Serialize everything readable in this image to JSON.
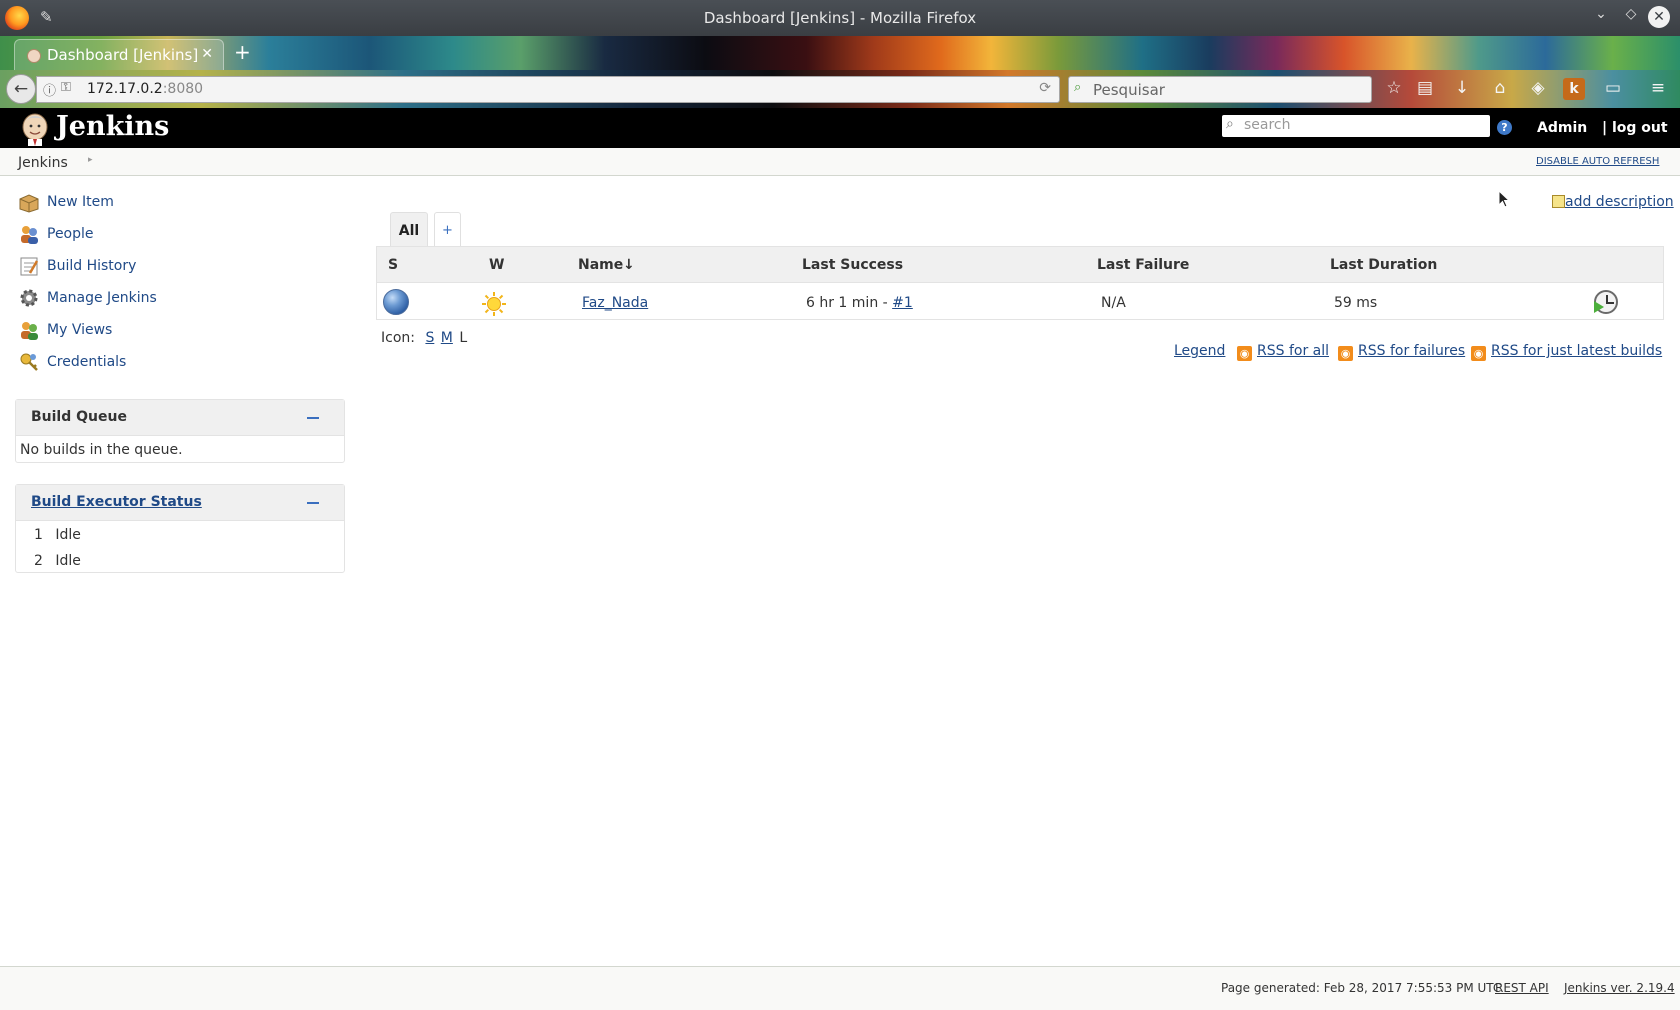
{
  "window": {
    "title": "Dashboard [Jenkins] - Mozilla Firefox"
  },
  "browser": {
    "tab_title": "Dashboard [Jenkins]",
    "url_host": "172.17.0.2",
    "url_port": ":8080",
    "search_placeholder": "Pesquisar"
  },
  "header": {
    "brand": "Jenkins",
    "search_placeholder": "search",
    "help_icon": "?",
    "user": "Admin",
    "logout": "| log out"
  },
  "breadcrumb": {
    "root": "Jenkins",
    "auto_refresh": "DISABLE AUTO REFRESH"
  },
  "sidebar": {
    "tasks": [
      {
        "label": "New Item",
        "icon": "new-item-icon"
      },
      {
        "label": "People",
        "icon": "people-icon"
      },
      {
        "label": "Build History",
        "icon": "build-history-icon"
      },
      {
        "label": "Manage Jenkins",
        "icon": "gear-icon"
      },
      {
        "label": "My Views",
        "icon": "my-views-icon"
      },
      {
        "label": "Credentials",
        "icon": "credentials-icon"
      }
    ],
    "build_queue": {
      "title": "Build Queue",
      "empty_text": "No builds in the queue."
    },
    "executors": {
      "title": "Build Executor Status",
      "rows": [
        {
          "num": "1",
          "status": "Idle"
        },
        {
          "num": "2",
          "status": "Idle"
        }
      ]
    }
  },
  "main": {
    "add_description": "add description",
    "tabs": [
      {
        "label": "All"
      },
      {
        "label": "+"
      }
    ],
    "table": {
      "headers": {
        "s": "S",
        "w": "W",
        "name": "Name",
        "sort_arrow": "↓",
        "last_success": "Last Success",
        "last_failure": "Last Failure",
        "last_duration": "Last Duration"
      },
      "rows": [
        {
          "name": "Faz_Nada",
          "last_success_text": "6 hr 1 min - ",
          "last_success_build": "#1",
          "last_failure": "N/A",
          "last_duration": "59 ms",
          "status": "blue-ball-icon",
          "weather": "sunny-icon"
        }
      ]
    },
    "icon_size": {
      "label": "Icon:",
      "s": "S",
      "m": "M",
      "l": "L"
    },
    "links": {
      "legend": "Legend",
      "rss_all": "RSS for all",
      "rss_failures": "RSS for failures",
      "rss_latest": "RSS for just latest builds"
    }
  },
  "footer": {
    "generated": "Page generated: Feb 28, 2017 7:55:53 PM UTC",
    "rest_api": "REST API",
    "version": "Jenkins ver. 2.19.4"
  }
}
